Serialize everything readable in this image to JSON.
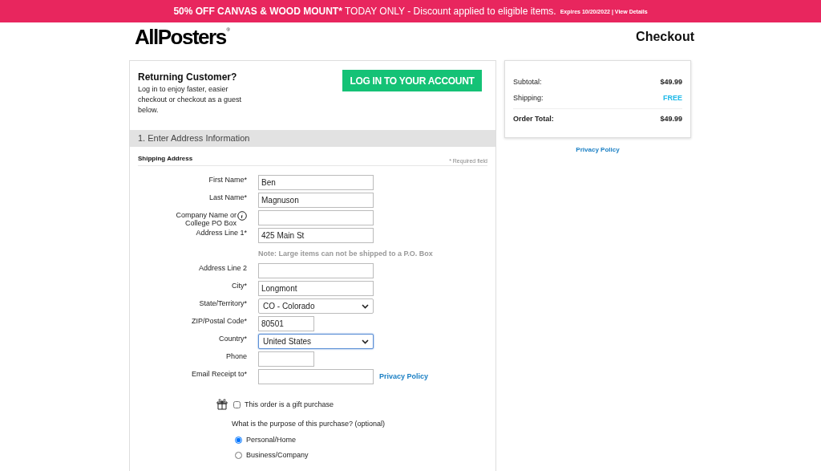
{
  "banner": {
    "headline_bold": "50% OFF CANVAS & WOOD MOUNT*",
    "headline": "TODAY ONLY - Discount applied to eligible items.",
    "expiry": "Expires 10/20/2022 |",
    "details_link": "View Details"
  },
  "header": {
    "logo": "AllPosters",
    "logo_mark": "®",
    "title": "Checkout"
  },
  "returning": {
    "title": "Returning Customer?",
    "text": "Log in to enjoy faster, easier checkout or checkout as a guest below.",
    "button": "LOG IN TO YOUR ACCOUNT"
  },
  "section": {
    "title": "1. Enter Address Information",
    "subtitle": "Shipping Address",
    "required_note": "* Required field"
  },
  "fields": [
    {
      "kind": "text",
      "label": "First Name*",
      "value": "Ben",
      "info": false,
      "focused": false
    },
    {
      "kind": "text",
      "label": "Last Name*",
      "value": "Magnuson",
      "info": false,
      "focused": false
    },
    {
      "kind": "text",
      "label": "Company Name or College PO Box",
      "info": true,
      "focused": false
    },
    {
      "kind": "text",
      "label": "Address Line 1*",
      "value": "425 Main St",
      "info": false,
      "focused": false
    },
    {
      "kind": "note",
      "text": "Note: Large items can not be shipped to a P.O. Box"
    },
    {
      "kind": "text",
      "label": "Address Line 2",
      "info": false,
      "focused": false
    },
    {
      "kind": "text",
      "label": "City*",
      "value": "Longmont",
      "info": false,
      "focused": false
    },
    {
      "kind": "select",
      "label": "State/Territory*",
      "value": "CO - Colorado",
      "info": false,
      "focused": false
    },
    {
      "kind": "short_text",
      "label": "ZIP/Postal Code*",
      "value": "80501",
      "info": false,
      "focused": false
    },
    {
      "kind": "select",
      "label": "Country*",
      "value": "United States",
      "info": false,
      "focused": true
    },
    {
      "kind": "short_text",
      "label": "Phone",
      "info": false,
      "focused": false
    },
    {
      "kind": "text",
      "label": "Email Receipt to*",
      "info": false,
      "focused": false,
      "link": "Privacy Policy"
    }
  ],
  "gift": {
    "label": "This order is a gift purchase",
    "checked": false
  },
  "purpose": {
    "question": "What is the purpose of this purchase? (optional)",
    "options": [
      {
        "label": "Personal/Home",
        "selected": true
      },
      {
        "label": "Business/Company",
        "selected": false
      }
    ]
  },
  "summary": {
    "rows": [
      {
        "label": "Subtotal:",
        "value": "$49.99",
        "kind": "normal"
      },
      {
        "label": "Shipping:",
        "value": "FREE",
        "kind": "highlight"
      },
      {
        "label": "Order Total:",
        "value": "$49.99",
        "kind": "total"
      }
    ],
    "link": "Privacy Policy"
  }
}
